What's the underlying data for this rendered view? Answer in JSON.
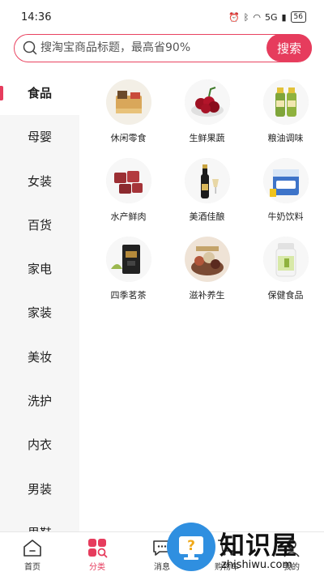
{
  "status_bar": {
    "time": "14:36",
    "network": "5G",
    "battery": "56"
  },
  "search": {
    "placeholder": "搜淘宝商品标题，最高省90%",
    "button_label": "搜索"
  },
  "sidebar": {
    "items": [
      {
        "label": "食品",
        "active": true
      },
      {
        "label": "母婴"
      },
      {
        "label": "女装"
      },
      {
        "label": "百货"
      },
      {
        "label": "家电"
      },
      {
        "label": "家装"
      },
      {
        "label": "美妆"
      },
      {
        "label": "洗护"
      },
      {
        "label": "内衣"
      },
      {
        "label": "男装"
      },
      {
        "label": "男鞋"
      }
    ]
  },
  "grid": {
    "items": [
      {
        "label": "休闲零食",
        "icon": "snacks-image"
      },
      {
        "label": "生鲜果蔬",
        "icon": "cherries-image"
      },
      {
        "label": "粮油调味",
        "icon": "oil-bottles-image"
      },
      {
        "label": "水产鲜肉",
        "icon": "meat-cubes-image"
      },
      {
        "label": "美酒佳酿",
        "icon": "wine-bottle-image"
      },
      {
        "label": "牛奶饮料",
        "icon": "milk-carton-image"
      },
      {
        "label": "四季茗茶",
        "icon": "tea-box-image"
      },
      {
        "label": "滋补养生",
        "icon": "tonic-herbs-image"
      },
      {
        "label": "保健食品",
        "icon": "vitamin-bottle-image"
      }
    ]
  },
  "bottom_nav": {
    "items": [
      {
        "label": "首页",
        "icon": "home-icon"
      },
      {
        "label": "分类",
        "icon": "category-icon",
        "active": true
      },
      {
        "label": "消息",
        "icon": "message-icon"
      },
      {
        "label": "购物车",
        "icon": "cart-icon"
      },
      {
        "label": "我的",
        "icon": "profile-icon"
      }
    ]
  },
  "watermark": {
    "title": "知识屋",
    "subtitle": "zhishiwu.com"
  },
  "colors": {
    "accent": "#e63c5d",
    "sidebar_bg": "#f6f6f6"
  }
}
